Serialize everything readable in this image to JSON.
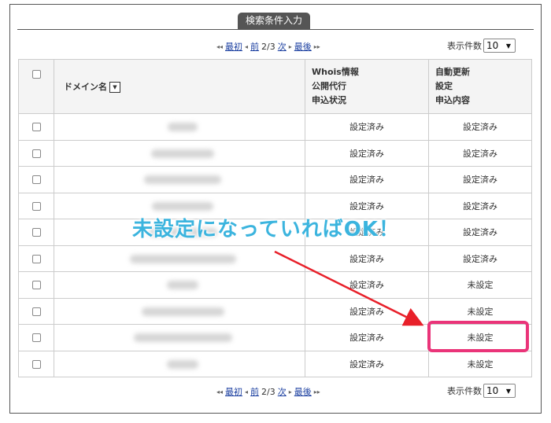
{
  "search_tab": "検索条件入力",
  "pager": {
    "first": "最初",
    "prev": "前",
    "page": "2/3",
    "next": "次",
    "last": "最後",
    "arrow_first": "◂◂",
    "arrow_prev": "◂",
    "arrow_next": "▸",
    "arrow_last": "▸▸"
  },
  "per_page": {
    "label": "表示件数",
    "value": "10"
  },
  "headers": {
    "domain": "ドメイン名",
    "sort_icon": "▼",
    "whois_l1": "Whois情報",
    "whois_l2": "公開代行",
    "whois_l3": "申込状況",
    "auto_l1": "自動更新",
    "auto_l2": "設定",
    "auto_l3": "申込内容"
  },
  "rows": [
    {
      "whois": "設定済み",
      "auto": "設定済み"
    },
    {
      "whois": "設定済み",
      "auto": "設定済み"
    },
    {
      "whois": "設定済み",
      "auto": "設定済み"
    },
    {
      "whois": "設定済み",
      "auto": "設定済み"
    },
    {
      "whois": "設定済み",
      "auto": "設定済み"
    },
    {
      "whois": "設定済み",
      "auto": "設定済み"
    },
    {
      "whois": "設定済み",
      "auto": "未設定"
    },
    {
      "whois": "設定済み",
      "auto": "未設定"
    },
    {
      "whois": "設定済み",
      "auto": "未設定"
    },
    {
      "whois": "設定済み",
      "auto": "未設定"
    }
  ],
  "annotation": "未設定になっていればOK！",
  "colors": {
    "annotation": "#3bb4de",
    "arrow": "#e8202a",
    "highlight": "#ea3479",
    "link": "#1b3fa0"
  }
}
